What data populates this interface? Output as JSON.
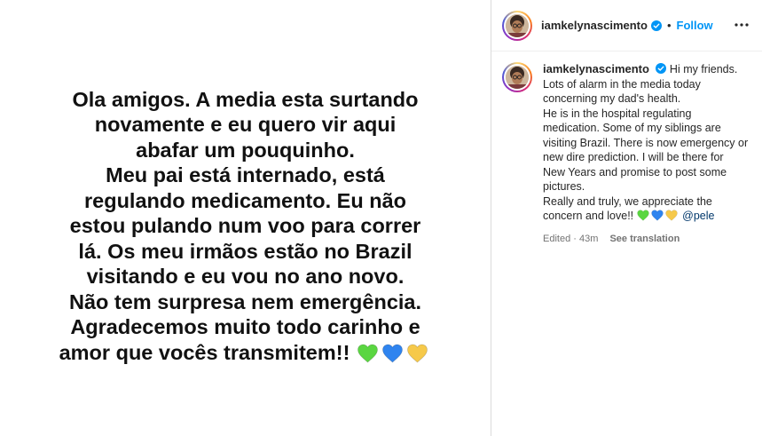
{
  "media": {
    "lines": [
      "Ola amigos. A media esta surtando",
      "novamente e eu quero vir aqui",
      "abafar um pouquinho.",
      "Meu pai está internado, está",
      "regulando medicamento. Eu não",
      "estou pulando num voo para correr",
      "lá. Os meu irmãos estão no Brazil",
      "visitando e eu vou no ano novo.",
      "Não tem surpresa nem emergência.",
      "Agradecemos muito todo carinho e",
      "amor que vocês transmitem!!"
    ],
    "hearts": [
      "#5ad641",
      "#2f84ef",
      "#f6c94a"
    ]
  },
  "header": {
    "username": "iamkelynascimento",
    "separator": "•",
    "follow_label": "Follow"
  },
  "caption": {
    "username": "iamkelynascimento",
    "text": "Hi my friends.\nLots of alarm in the media today concerning my dad's health.\nHe is in the hospital regulating medication. Some of my siblings are visiting Brazil. There is now emergency or new dire prediction. I will be there for New Years and promise to post some pictures.\nReally and truly, we appreciate the concern and love!!",
    "mention": "@pele",
    "edited_time": "Edited · 43m",
    "see_translation": "See translation"
  },
  "colors": {
    "accent": "#0095f6",
    "verified": "#0095f6",
    "secondary_text": "#737373",
    "divider": "#dbdbdb"
  }
}
